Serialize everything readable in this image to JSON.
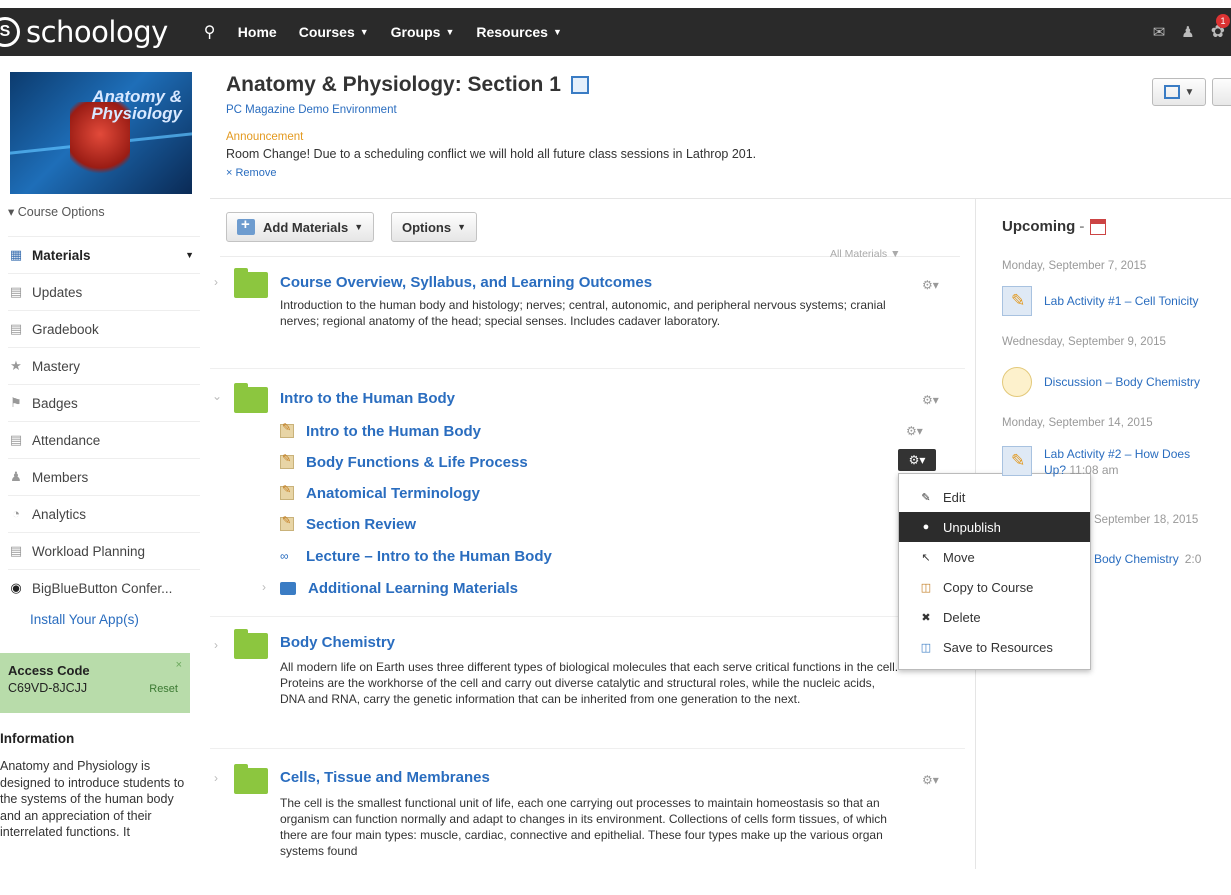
{
  "app": {
    "brand": "schoology",
    "nav": [
      "Home",
      "Courses",
      "Groups",
      "Resources"
    ],
    "notification_count": "1"
  },
  "course": {
    "image_title": "Anatomy & Physiology",
    "title": "Anatomy & Physiology: Section 1",
    "subtitle": "PC Magazine Demo Environment",
    "announcement_label": "Announcement",
    "announcement_text": "Room Change!  Due to a scheduling conflict we will hold all future class sessions in Lathrop 201.",
    "announcement_remove": "× Remove"
  },
  "sidebar": {
    "course_options": "Course Options",
    "items": [
      {
        "label": "Materials",
        "icon": "materials-icon"
      },
      {
        "label": "Updates",
        "icon": "updates-icon"
      },
      {
        "label": "Gradebook",
        "icon": "gradebook-icon"
      },
      {
        "label": "Mastery",
        "icon": "mastery-icon"
      },
      {
        "label": "Badges",
        "icon": "badges-icon"
      },
      {
        "label": "Attendance",
        "icon": "attendance-icon"
      },
      {
        "label": "Members",
        "icon": "members-icon"
      },
      {
        "label": "Analytics",
        "icon": "analytics-icon"
      },
      {
        "label": "Workload Planning",
        "icon": "workload-icon"
      },
      {
        "label": "BigBlueButton Confer...",
        "icon": "bigbluebutton-icon"
      }
    ],
    "install_app": "Install Your App(s)",
    "access_code_label": "Access Code",
    "access_code_value": "C69VD-8JCJJ",
    "access_reset": "Reset",
    "info_title": "Information",
    "info_text": "Anatomy and Physiology is designed to introduce students to the systems of the human body and an appreciation of their interrelated functions. It"
  },
  "toolbar": {
    "add_materials": "Add Materials",
    "options": "Options",
    "filter": "All Materials"
  },
  "materials": [
    {
      "title": "Course Overview, Syllabus, and Learning Outcomes",
      "desc": "Introduction to the human body and histology; nerves; central, autonomic, and peripheral nervous systems; cranial nerves; regional anatomy of the head; special senses. Includes cadaver laboratory."
    },
    {
      "title": "Intro to the Human Body",
      "children": [
        "Intro to the Human Body",
        "Body Functions & Life Process",
        "Anatomical Terminology",
        "Section Review",
        "Lecture – Intro to the Human Body",
        "Additional Learning Materials"
      ]
    },
    {
      "title": "Body Chemistry",
      "desc": "All modern life on Earth uses three different types of biological molecules that each serve critical functions in the cell.  Proteins are the workhorse of the cell and carry out diverse catalytic and structural roles, while the nucleic acids, DNA and RNA, carry the genetic information that can be inherited from one generation to the next."
    },
    {
      "title": "Cells, Tissue and Membranes",
      "desc": "The cell is the smallest functional unit of life, each one carrying out processes to maintain homeostasis so that an organism can function normally and adapt to changes in its environment. Collections of cells form tissues, of which there are four main types: muscle, cardiac, connective and epithelial. These four types make up the various organ systems found"
    }
  ],
  "context_menu": [
    "Edit",
    "Unpublish",
    "Move",
    "Copy to Course",
    "Delete",
    "Save to Resources"
  ],
  "upcoming": {
    "title": "Upcoming",
    "entries": [
      {
        "date": "Monday, September 7, 2015",
        "item": "Lab Activity #1 – Cell Tonicity"
      },
      {
        "date": "Wednesday, September 9, 2015",
        "item": "Discussion – Body Chemistry"
      },
      {
        "date": "Monday, September 14, 2015",
        "item": "Lab Activity #2 – How Does",
        "item2": "Up?",
        "time": "11:08 am"
      },
      {
        "date": "September 18, 2015",
        "item": "Body Chemistry",
        "time": "2:0"
      }
    ]
  },
  "colors": {
    "topbar": "#2a2a2a",
    "link": "#2a6dbf",
    "folder": "#8cc63f",
    "announcement": "#e39a21",
    "access_bg": "#b8dcaa"
  }
}
